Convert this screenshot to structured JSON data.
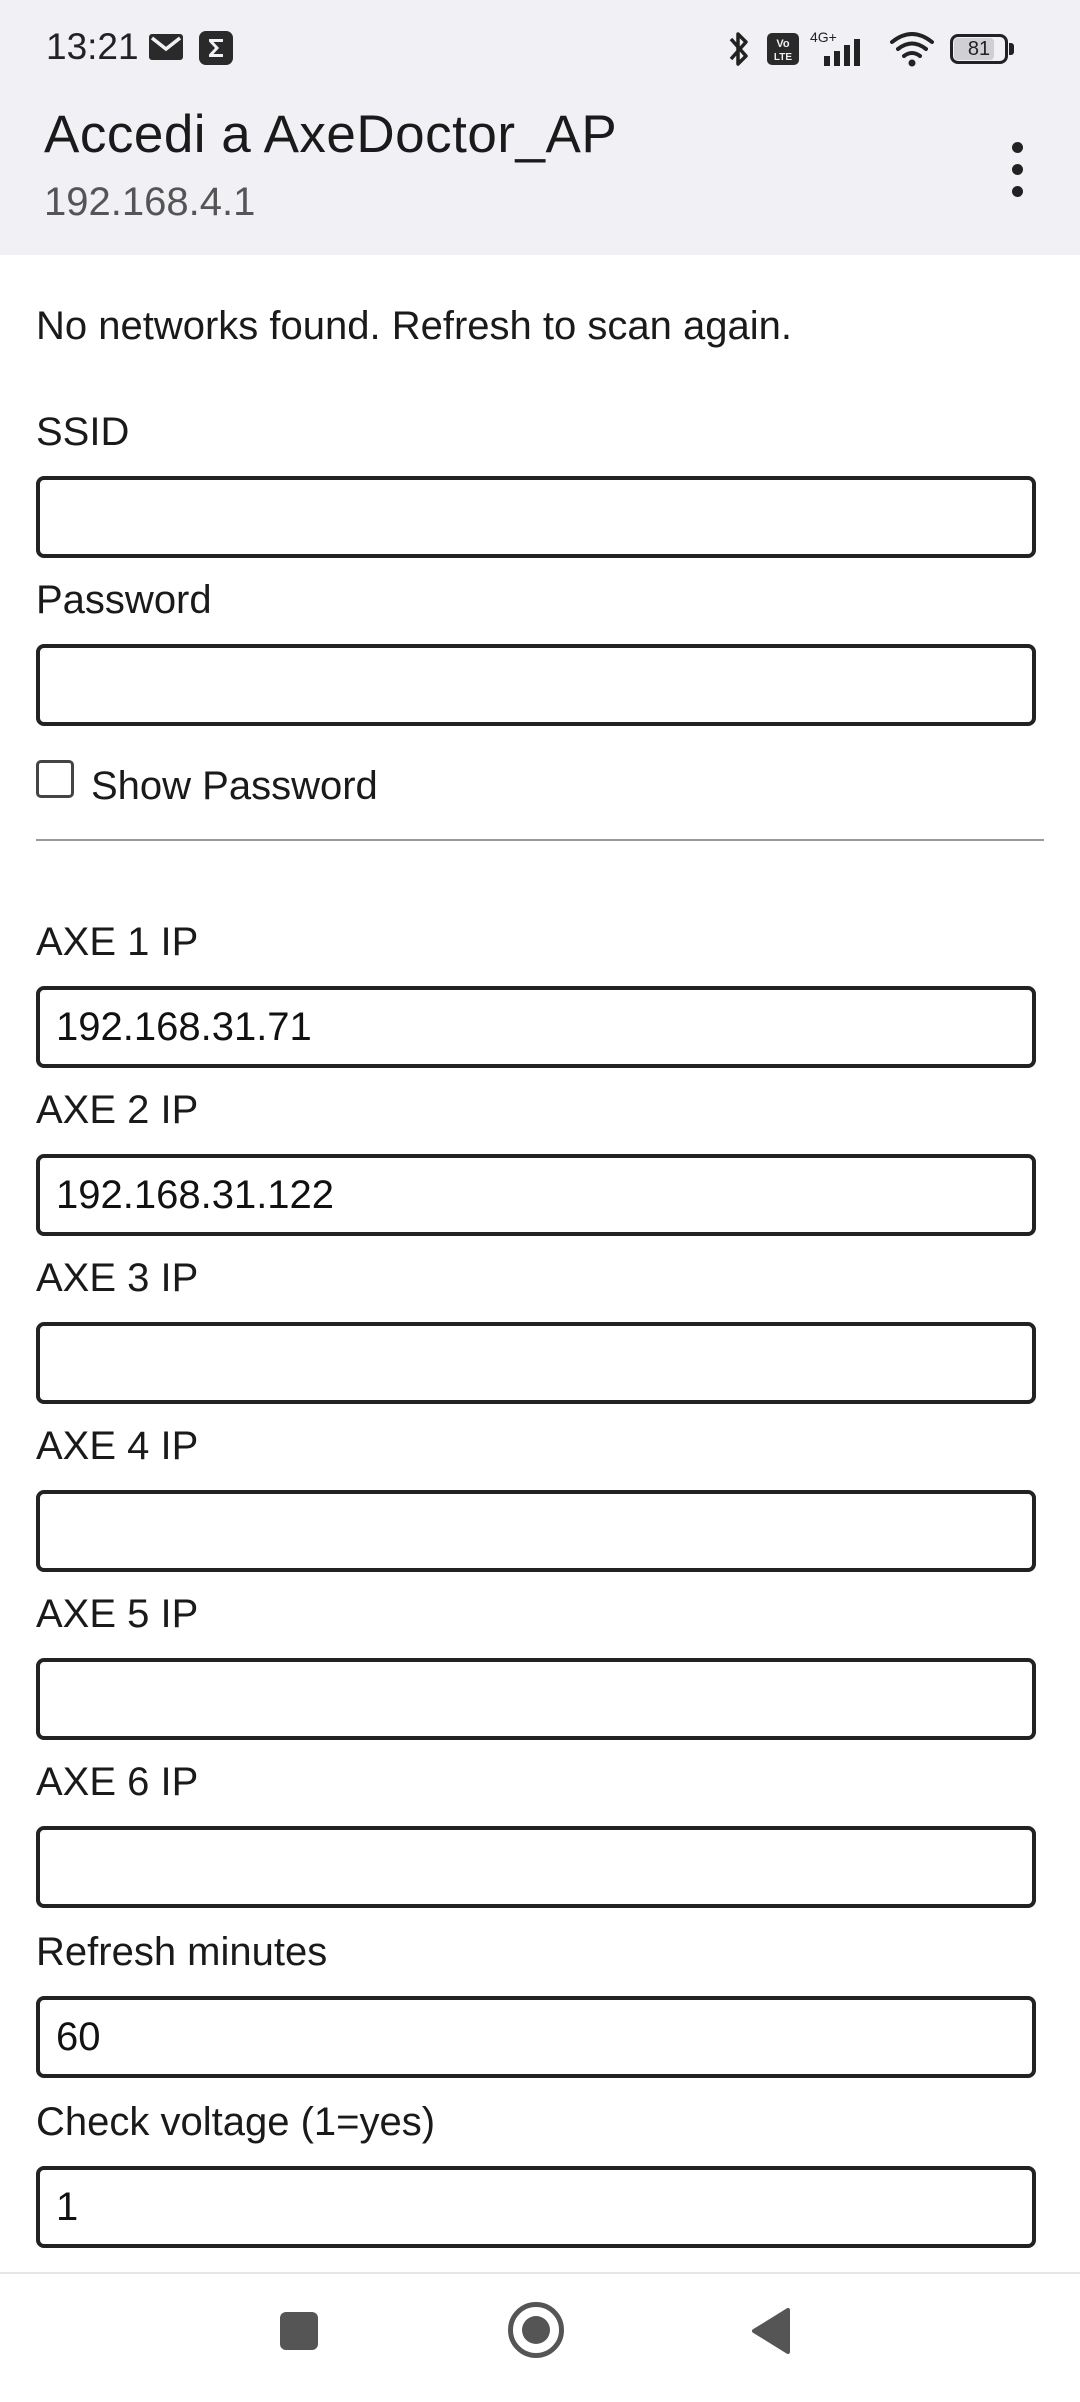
{
  "status_bar": {
    "time": "13:21",
    "notification_icons": [
      "mail-icon",
      "sigma-app-icon"
    ],
    "system_icons": [
      "bluetooth-icon",
      "volte-icon",
      "signal-4g-icon",
      "wifi-icon",
      "battery-icon"
    ],
    "network_label": "4G+",
    "volte_label": "Vo LTE",
    "battery_level": "81"
  },
  "header": {
    "title": "Accedi a AxeDoctor_AP",
    "url": "192.168.4.1",
    "menu_icon": "more-vert-icon"
  },
  "form": {
    "scan_message": "No networks found. Refresh to scan again.",
    "ssid_label": "SSID",
    "ssid_value": "",
    "password_label": "Password",
    "password_value": "",
    "show_password_label": "Show Password",
    "show_password_checked": false,
    "axe_fields": [
      {
        "label": "AXE 1 IP",
        "value": "192.168.31.71"
      },
      {
        "label": "AXE 2 IP",
        "value": "192.168.31.122"
      },
      {
        "label": "AXE 3 IP",
        "value": ""
      },
      {
        "label": "AXE 4 IP",
        "value": ""
      },
      {
        "label": "AXE 5 IP",
        "value": ""
      },
      {
        "label": "AXE 6 IP",
        "value": ""
      }
    ],
    "refresh_label": "Refresh minutes",
    "refresh_value": "60",
    "voltage_label": "Check voltage (1=yes)",
    "voltage_value": "1"
  },
  "nav_bar": {
    "icons": [
      "recents-icon",
      "home-icon",
      "back-icon"
    ]
  }
}
